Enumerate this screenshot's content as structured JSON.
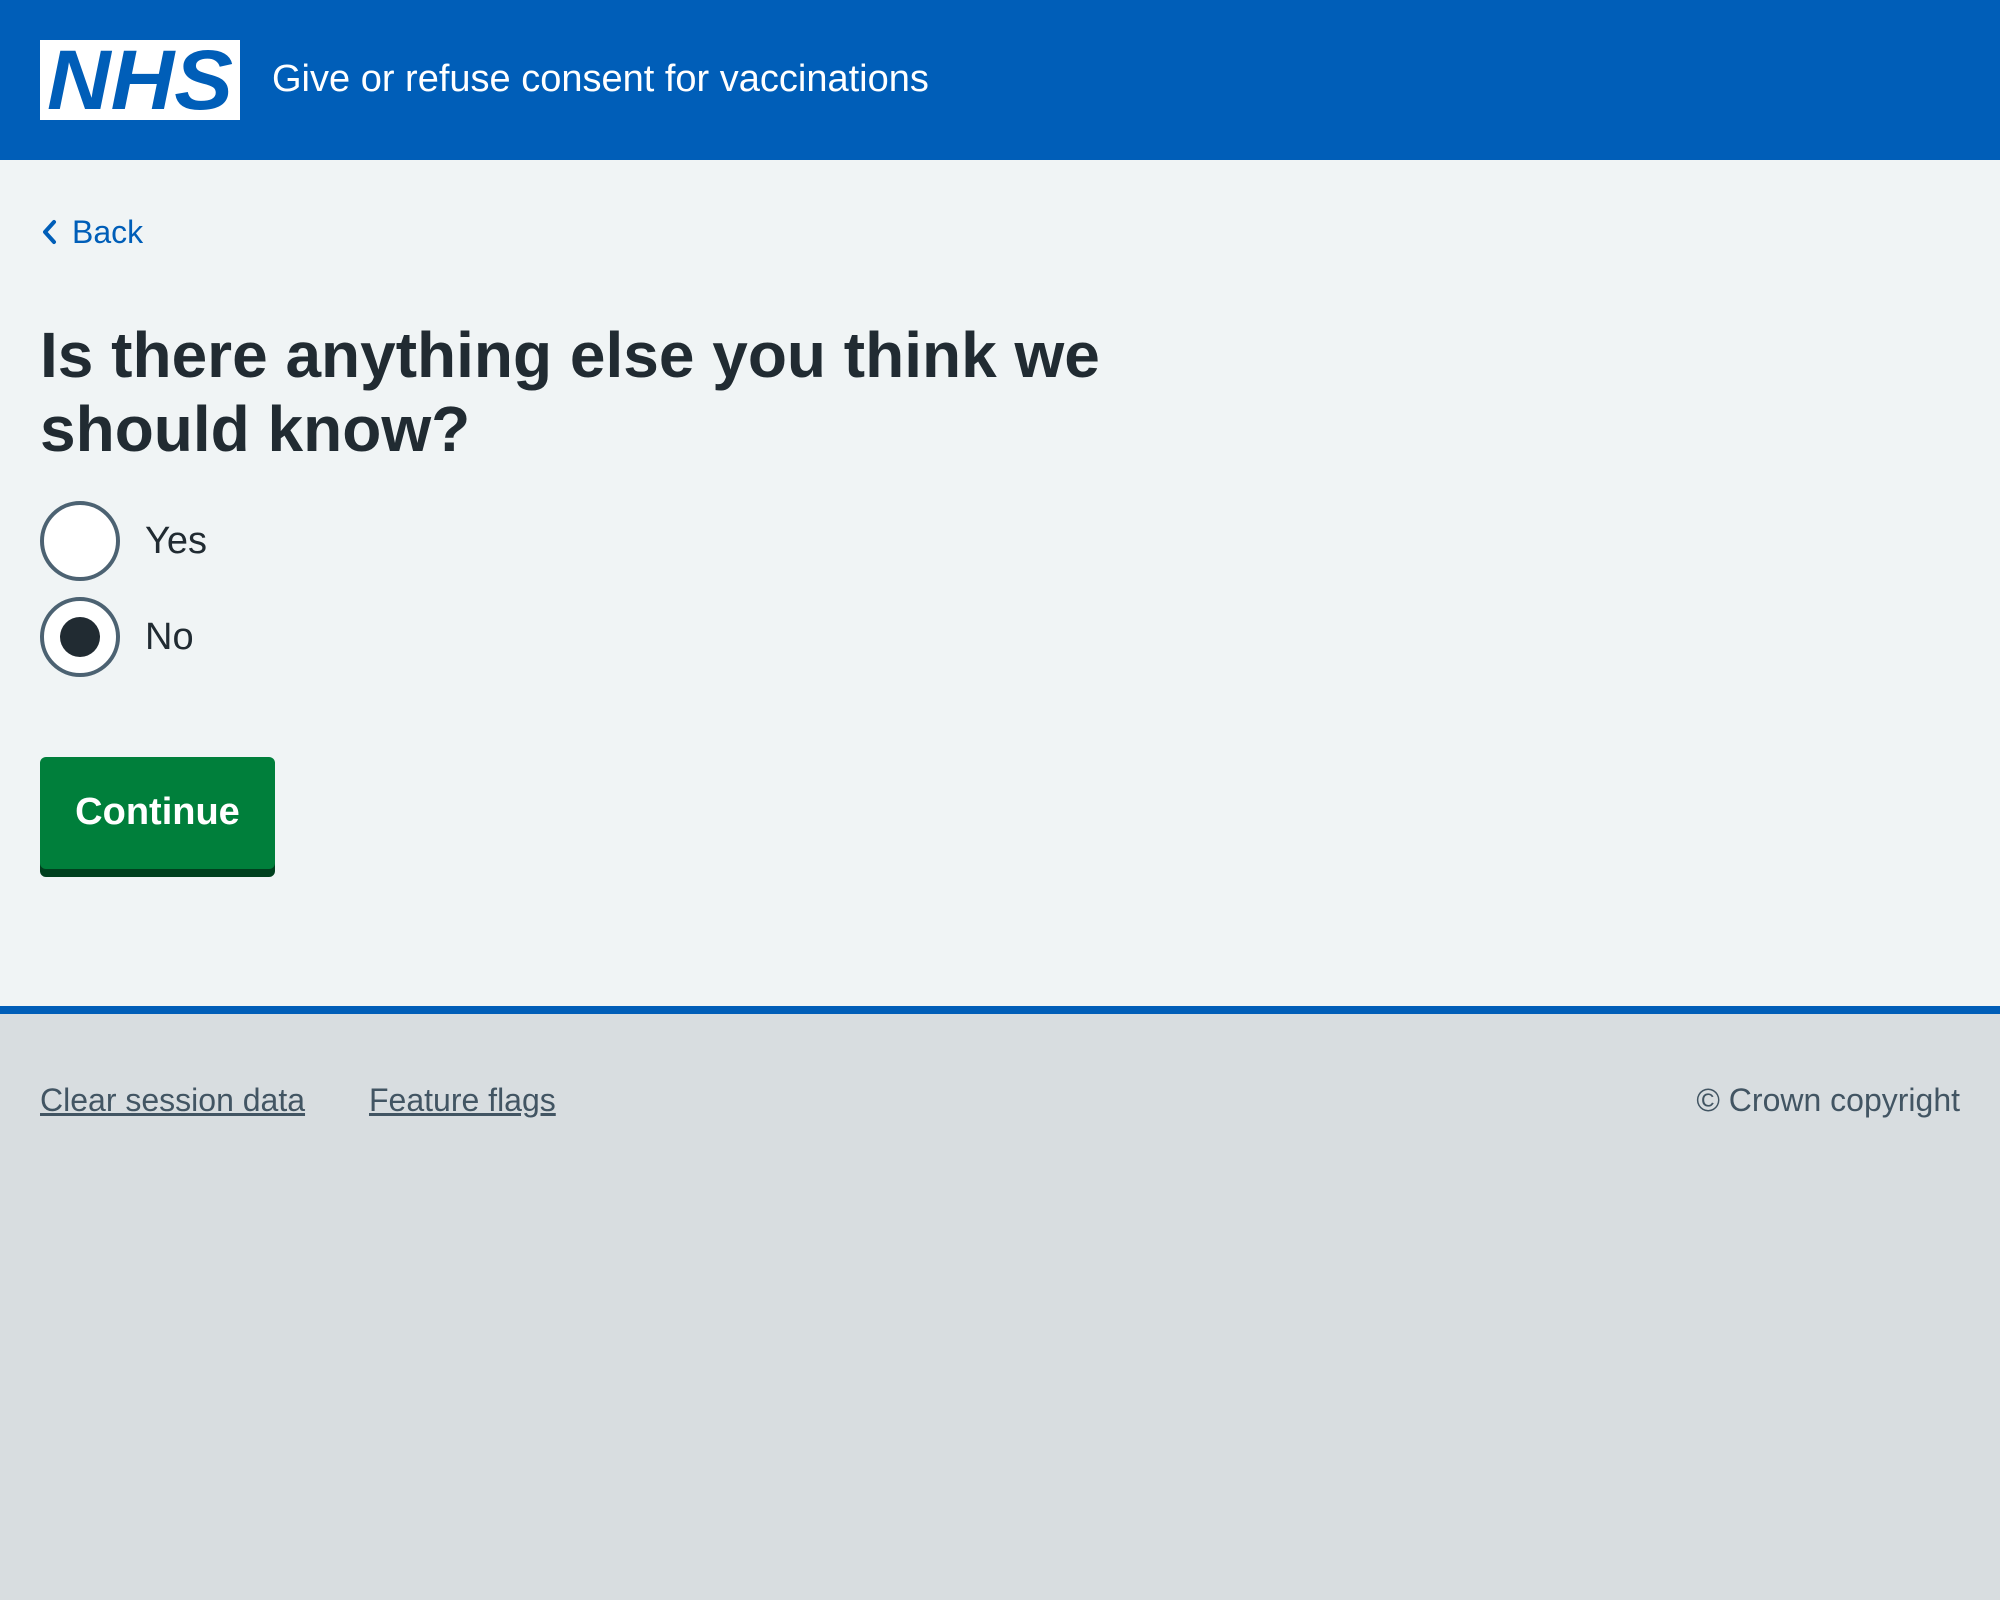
{
  "header": {
    "logo_text": "NHS",
    "service_name": "Give or refuse consent for vaccinations"
  },
  "main": {
    "back_label": "Back",
    "question": "Is there anything else you think we should know?",
    "options": [
      {
        "label": "Yes",
        "selected": false
      },
      {
        "label": "No",
        "selected": true
      }
    ],
    "continue_label": "Continue"
  },
  "footer": {
    "links": [
      "Clear session data",
      "Feature flags"
    ],
    "copyright": "© Crown copyright"
  },
  "colors": {
    "header_blue": "#005eb8",
    "page_background": "#f0f4f5",
    "footer_background": "#d8dde0",
    "button_green": "#007f3b",
    "text": "#212b32",
    "secondary_text": "#425563"
  }
}
